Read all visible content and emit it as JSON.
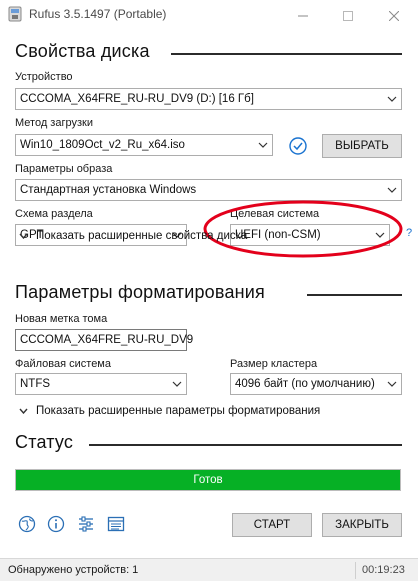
{
  "window": {
    "title": "Rufus 3.5.1497 (Portable)"
  },
  "drive_properties": {
    "heading": "Свойства диска",
    "device_label": "Устройство",
    "device_value": "CCCOMA_X64FRE_RU-RU_DV9 (D:) [16 Гб]",
    "boot_method_label": "Метод загрузки",
    "boot_method_value": "Win10_1809Oct_v2_Ru_x64.iso",
    "select_button": "ВЫБРАТЬ",
    "image_options_label": "Параметры образа",
    "image_options_value": "Стандартная установка Windows",
    "partition_scheme_label": "Схема раздела",
    "partition_scheme_value": "GPT",
    "target_system_label": "Целевая система",
    "target_system_value": "UEFI (non-CSM)",
    "help_mark": "?",
    "advanced_toggle": "Показать расширенные свойства диска"
  },
  "format_options": {
    "heading": "Параметры форматирования",
    "volume_label_label": "Новая метка тома",
    "volume_label_value": "CCCOMA_X64FRE_RU-RU_DV9",
    "file_system_label": "Файловая система",
    "file_system_value": "NTFS",
    "cluster_size_label": "Размер кластера",
    "cluster_size_value": "4096 байт (по умолчанию)",
    "advanced_toggle": "Показать расширенные параметры форматирования"
  },
  "status": {
    "heading": "Статус",
    "progress_text": "Готов",
    "progress_fraction": 1.0
  },
  "toolbar": {
    "icons": [
      "globe-icon",
      "info-icon",
      "settings-sliders-icon",
      "log-icon"
    ],
    "start_button": "СТАРТ",
    "close_button": "ЗАКРЫТЬ"
  },
  "statusbar": {
    "devices_found": "Обнаружено устройств: 1",
    "elapsed": "00:19:23"
  },
  "colors": {
    "progress_green": "#06b025",
    "annotation_red": "#e3001b",
    "check_blue": "#1a73d0"
  }
}
